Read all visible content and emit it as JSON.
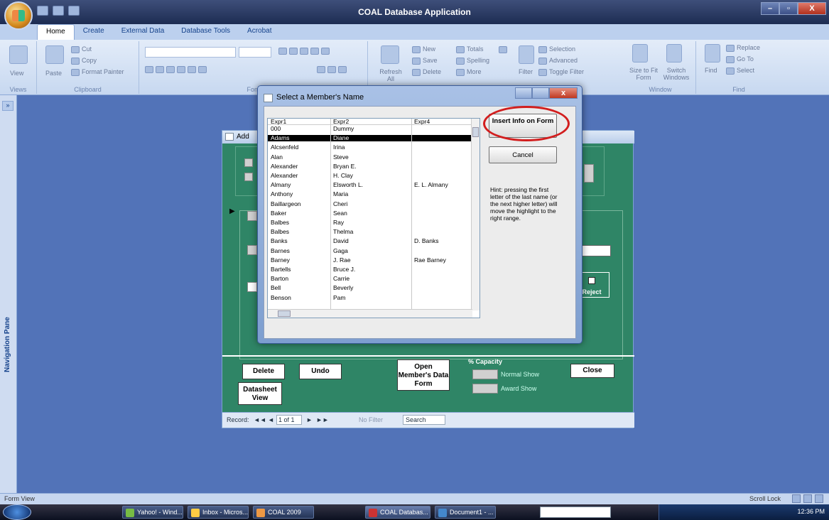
{
  "app": {
    "title": "COAL Database Application"
  },
  "window_controls": {
    "minimize": "–",
    "maximize": "▫",
    "close": "X"
  },
  "ribbon": {
    "tabs": [
      "Home",
      "Create",
      "External Data",
      "Database Tools",
      "Acrobat"
    ],
    "groups": {
      "views": {
        "label": "Views",
        "view": "View"
      },
      "clipboard": {
        "label": "Clipboard",
        "paste": "Paste",
        "cut": "Cut",
        "copy": "Copy",
        "format_painter": "Format Painter"
      },
      "font": {
        "label": "Font"
      },
      "records": {
        "refresh": "Refresh All",
        "new": "New",
        "save": "Save",
        "delete": "Delete",
        "totals": "Totals",
        "spelling": "Spelling",
        "more": "More"
      },
      "sort_filter": {
        "filter": "Filter",
        "selection": "Selection",
        "advanced": "Advanced",
        "toggle_filter": "Toggle Filter"
      },
      "window": {
        "label": "Window",
        "size_to_fit": "Size to Fit Form",
        "switch_windows": "Switch Windows"
      },
      "find": {
        "label": "Find",
        "find": "Find",
        "replace": "Replace",
        "goto": "Go To",
        "select": "Select"
      }
    }
  },
  "nav_pane": {
    "label": "Navigation Pane",
    "toggle": "»"
  },
  "dialog": {
    "title": "Select a Member's Name",
    "columns": [
      "Expr1",
      "Expr2",
      "Expr4"
    ],
    "rows": [
      [
        "000",
        "Dummy",
        ""
      ],
      [
        "Adams",
        "Diane",
        ""
      ],
      [
        "Alcsenfeld",
        "Irina",
        ""
      ],
      [
        "Alan",
        "Steve",
        ""
      ],
      [
        "Alexander",
        "Bryan E.",
        ""
      ],
      [
        "Alexander",
        "H. Clay",
        ""
      ],
      [
        "Almany",
        "Elsworth L.",
        "E. L. Almany"
      ],
      [
        "Anthony",
        "Maria",
        ""
      ],
      [
        "Baillargeon",
        "Cheri",
        ""
      ],
      [
        "Baker",
        "Sean",
        ""
      ],
      [
        "Balbes",
        "Ray",
        ""
      ],
      [
        "Balbes",
        "Thelma",
        ""
      ],
      [
        "Banks",
        "David",
        "D. Banks"
      ],
      [
        "Barnes",
        "Gaga",
        ""
      ],
      [
        "Barney",
        "J. Rae",
        "Rae Barney"
      ],
      [
        "Bartells",
        "Bruce J.",
        ""
      ],
      [
        "Barton",
        "Carrie",
        ""
      ],
      [
        "Bell",
        "Beverly",
        ""
      ],
      [
        "Benson",
        "Pam",
        ""
      ]
    ],
    "selected_index": 1,
    "insert_button": "Insert Info on Form",
    "cancel_button": "Cancel",
    "hint": "Hint: pressing the first letter of the last name (or the next higher letter) will move the highlight to the right range."
  },
  "form": {
    "title": "Add",
    "buttons": {
      "delete": "Delete",
      "undo": "Undo",
      "datasheet": "Datasheet View",
      "open_member": "Open Member's Data Form",
      "close": "Close",
      "reject": "Reject"
    },
    "capacity_label": "% Capacity",
    "normal_show": "Normal Show",
    "award_show": "Award Show",
    "record_nav": {
      "label": "Record:",
      "first": "◄◄",
      "prev": "◄",
      "position": "1 of 1",
      "next": "►",
      "last": "►►",
      "filter": "No Filter",
      "search": "Search"
    }
  },
  "statusbar": {
    "left": "Form View",
    "right": "Scroll Lock"
  },
  "taskbar": {
    "items": [
      "Yahoo! - Wind...",
      "Inbox - Micros...",
      "COAL 2009",
      "COAL Databas...",
      "Document1 - ..."
    ],
    "clock": "12:36 PM"
  }
}
